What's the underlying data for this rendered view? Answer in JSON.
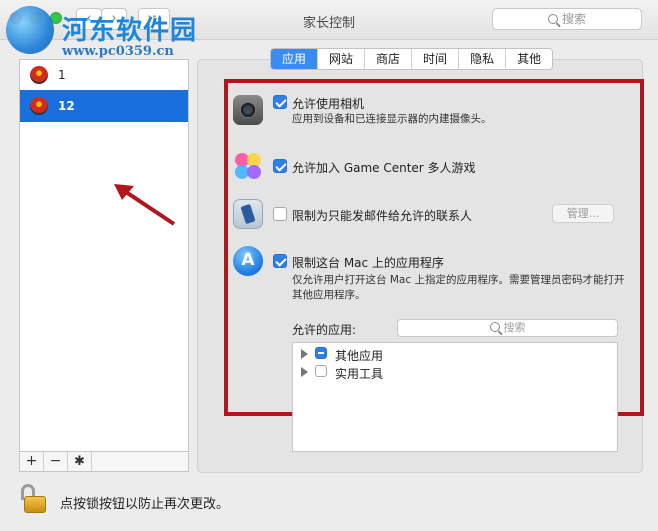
{
  "window": {
    "title": "家长控制",
    "search_placeholder": "搜索",
    "nav_back": "‹",
    "nav_forward": "›",
    "grid_glyph": "∷∷"
  },
  "watermark": {
    "title": "河东软件园",
    "url": "www.pc0359.cn"
  },
  "users": [
    {
      "name": "1",
      "selected": false
    },
    {
      "name": "12",
      "selected": true
    }
  ],
  "list_tools": {
    "add": "+",
    "remove": "−",
    "gear": "✱"
  },
  "tabs": [
    {
      "label": "应用",
      "active": true
    },
    {
      "label": "网站",
      "active": false
    },
    {
      "label": "商店",
      "active": false
    },
    {
      "label": "时间",
      "active": false
    },
    {
      "label": "隐私",
      "active": false
    },
    {
      "label": "其他",
      "active": false
    }
  ],
  "options": {
    "camera": {
      "label": "允许使用相机",
      "desc": "应用到设备和已连接显示器的内建摄像头。",
      "checked": true,
      "icon": "camera-icon"
    },
    "game_center": {
      "label": "允许加入 Game Center 多人游戏",
      "checked": true,
      "icon": "game-center-icon"
    },
    "mail": {
      "label": "限制为只能发邮件给允许的联系人",
      "checked": false,
      "icon": "mail-icon",
      "manage_label": "管理..."
    },
    "apps": {
      "label": "限制这台 Mac 上的应用程序",
      "desc": "仅允许用户打开这台 Mac 上指定的应用程序。需要管理员密码才能打开其他应用程序。",
      "checked": true,
      "icon": "app-store-icon"
    }
  },
  "allowed_apps": {
    "label": "允许的应用:",
    "search_placeholder": "搜索",
    "items": [
      {
        "label": "其他应用",
        "state": "mixed"
      },
      {
        "label": "实用工具",
        "state": "unchecked"
      }
    ]
  },
  "footer": {
    "lock_text": "点按锁按钮以防止再次更改。"
  },
  "colors": {
    "highlight_box": "#b1161b",
    "selection": "#1a6fde",
    "accent": "#3b8cf2"
  }
}
